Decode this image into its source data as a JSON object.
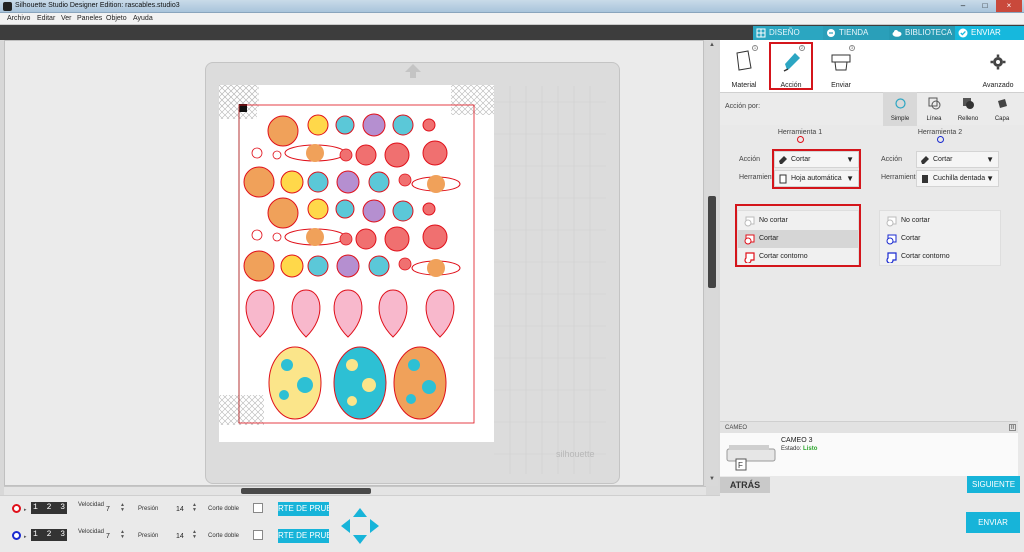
{
  "window": {
    "title": "Silhouette Studio Designer Edition: rascables.studio3",
    "minimize": "–",
    "maximize": "□",
    "close": "×"
  },
  "menu": [
    "Archivo",
    "Editar",
    "Ver",
    "Paneles",
    "Objeto",
    "Ayuda"
  ],
  "top_tabs": [
    {
      "label": "DISEÑO",
      "icon": "grid-icon"
    },
    {
      "label": "TIENDA",
      "icon": "store-icon"
    },
    {
      "label": "BIBLIOTECA",
      "icon": "cloud-icon"
    },
    {
      "label": "ENVIAR",
      "icon": "check-icon"
    }
  ],
  "mat_logo": "silhouette",
  "panel": {
    "steps": [
      {
        "label": "Material",
        "badge": "1"
      },
      {
        "label": "Acción",
        "badge": "2"
      },
      {
        "label": "Enviar",
        "badge": "3"
      }
    ],
    "advanced_label": "Avanzado",
    "action_by_label": "Acción por:",
    "modes": [
      "Simple",
      "Línea",
      "Relleno",
      "Capa"
    ],
    "tool1": {
      "header": "Herramienta 1",
      "color": "#e0101a"
    },
    "tool2": {
      "header": "Herramienta 2",
      "color": "#1a2ad0"
    },
    "action_label": "Acción",
    "tool_label": "Herramienta",
    "tool1_action": "Cortar",
    "tool1_tool": "Hoja automática",
    "tool2_action": "Cortar",
    "tool2_tool": "Cuchilla dentada",
    "options": [
      "No cortar",
      "Cortar",
      "Cortar contorno"
    ],
    "selected_option": "Cortar",
    "cameo_header": "CAMEO",
    "pin": "II",
    "device_name": "CAMEO 3",
    "device_status_label": "Estado:",
    "device_status_value": "Listo",
    "back_button": "ATRÁS",
    "next_button": "SIGUIENTE",
    "send_button": "ENVIAR"
  },
  "bottom_rows": [
    {
      "dot_color": "#e0101a",
      "digits": "1 2 3",
      "speed_label": "Velocidad",
      "speed": "7",
      "pressure_label": "Presión",
      "pressure": "14",
      "double_label": "Corte doble",
      "test_label": "RTE DE PRUEB"
    },
    {
      "dot_color": "#1a2ad0",
      "digits": "1 2 3",
      "speed_label": "Velocidad",
      "speed": "7",
      "pressure_label": "Presión",
      "pressure": "14",
      "double_label": "Corte doble",
      "test_label": "RTE DE PRUEB"
    }
  ],
  "colors": {
    "accent": "#17b4d9",
    "cut_line": "#e0101a",
    "planet_orange": "#f0a15a",
    "planet_yellow": "#ffd84a",
    "planet_blue": "#5bc8d8",
    "planet_purple": "#b58fd0",
    "planet_red": "#f07070",
    "balloon_pink": "#f8b8cc",
    "egg_yellow": "#fbe58a",
    "egg_teal": "#2dc0d4"
  }
}
